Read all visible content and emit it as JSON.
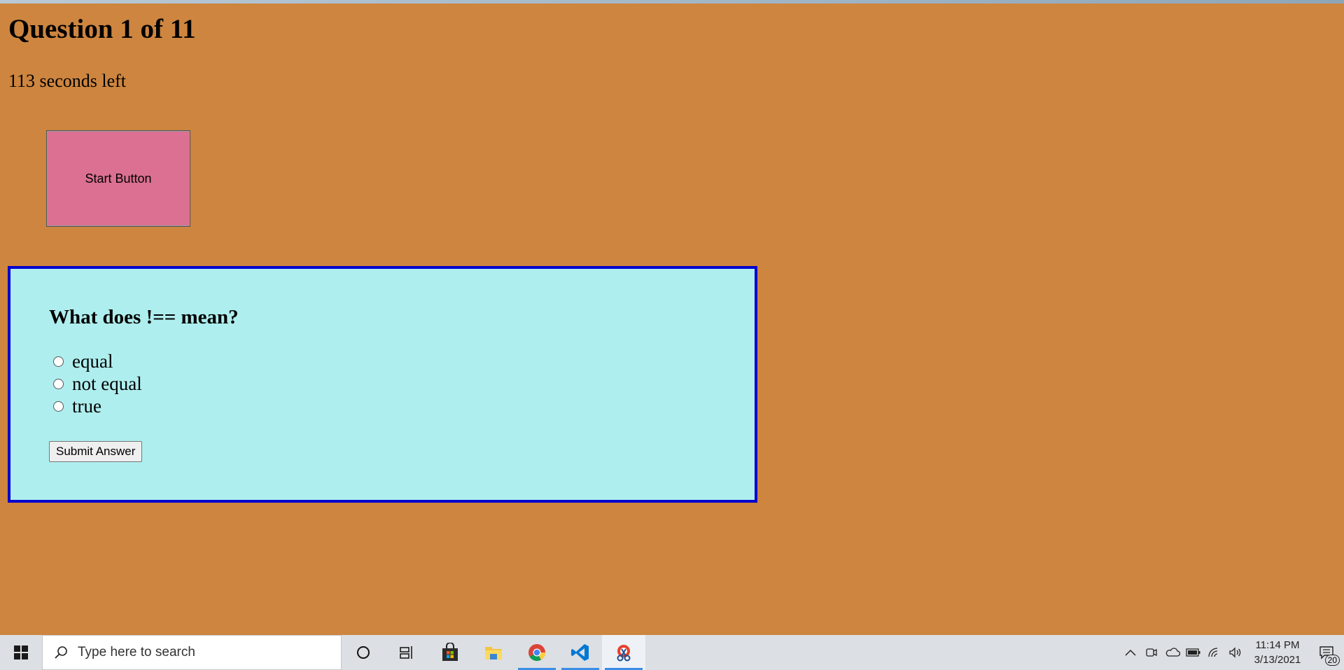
{
  "quiz": {
    "heading": "Question 1 of 11",
    "timer": "113 seconds left",
    "start_button_label": "Start Button",
    "question": "What does !== mean?",
    "options": [
      "equal",
      "not equal",
      "true"
    ],
    "submit_label": "Submit Answer"
  },
  "colors": {
    "page_background": "#cd853f",
    "start_button": "#db7093",
    "card_background": "#afeeee",
    "card_border": "#0000cd"
  },
  "taskbar": {
    "search_placeholder": "Type here to search",
    "pinned_apps": [
      "cortana-icon",
      "task-view-icon",
      "store-icon",
      "file-explorer-icon",
      "chrome-icon",
      "vscode-icon",
      "snip-sketch-icon"
    ],
    "tray_icons": [
      "chevron-up-icon",
      "meet-now-icon",
      "onedrive-icon",
      "battery-icon",
      "wifi-icon",
      "volume-icon"
    ],
    "time": "11:14 PM",
    "date": "3/13/2021",
    "notification_count": "20"
  }
}
